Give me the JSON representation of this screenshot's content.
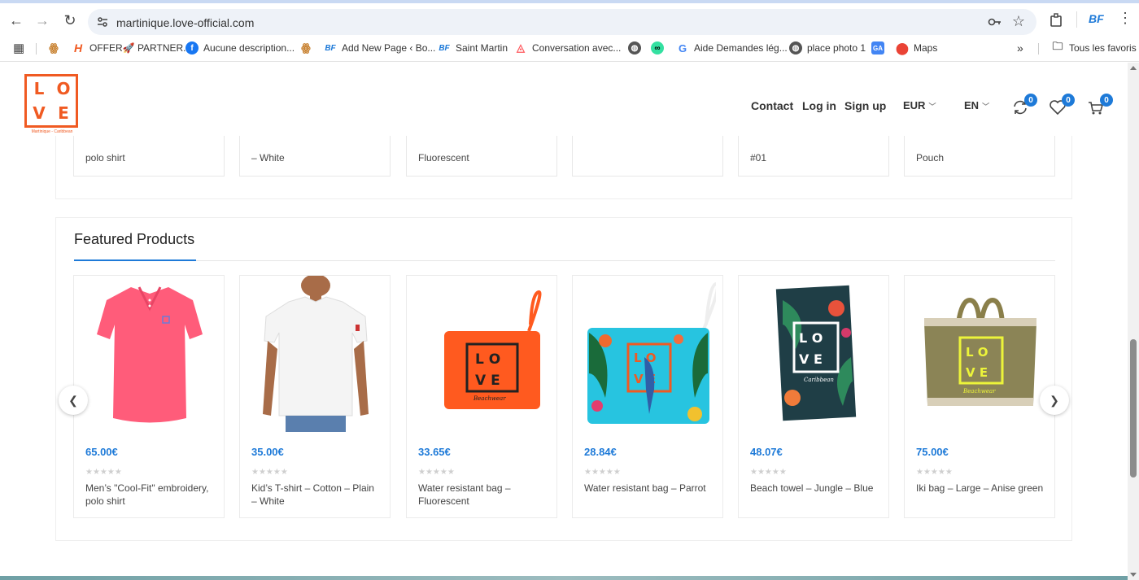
{
  "browser": {
    "url": "martinique.love-official.com",
    "bookmarks": [
      {
        "label": "",
        "icon": "squirrel-icon"
      },
      {
        "label": "OFFER🚀 PARTNER...",
        "icon": "h-logo-icon"
      },
      {
        "label": "Aucune description...",
        "icon": "facebook-icon"
      },
      {
        "label": "",
        "icon": "squirrel-icon"
      },
      {
        "label": "Add New Page ‹ Bo...",
        "icon": "bf-icon"
      },
      {
        "label": "Saint Martin",
        "icon": "bf-icon"
      },
      {
        "label": "Conversation avec...",
        "icon": "airbnb-icon"
      },
      {
        "label": "",
        "icon": "globe-icon"
      },
      {
        "label": "",
        "icon": "tripadvisor-icon"
      },
      {
        "label": "Aide Demandes lég...",
        "icon": "google-icon"
      },
      {
        "label": "place photo 1",
        "icon": "globe-icon"
      },
      {
        "label": "",
        "icon": "translate-icon"
      },
      {
        "label": "Maps",
        "icon": "maps-icon"
      }
    ],
    "bookmarks_overflow": "»",
    "all_bookmarks": "Tous les favoris"
  },
  "header": {
    "logo_letters": [
      "L",
      "O",
      "V",
      "E"
    ],
    "logo_sub": "Martinique - Caribbean",
    "nav": [
      "Contact",
      "Log in",
      "Sign up"
    ],
    "currency": "EUR",
    "language": "EN",
    "compare_count": "0",
    "wishlist_count": "0",
    "cart_count": "0"
  },
  "previous_row": [
    "polo shirt",
    "– White",
    "Fluorescent",
    "",
    "#01",
    "Pouch"
  ],
  "featured": {
    "title": "Featured Products",
    "products": [
      {
        "price": "65.00€",
        "name": "Men’s \"Cool-Fit\" embroidery, polo shirt",
        "image": "pink-polo-shirt"
      },
      {
        "price": "35.00€",
        "name": "Kid’s T-shirt – Cotton – Plain – White",
        "image": "white-tshirt"
      },
      {
        "price": "33.65€",
        "name": "Water resistant bag – Fluorescent",
        "image": "orange-pouch"
      },
      {
        "price": "28.84€",
        "name": "Water resistant bag – Parrot",
        "image": "parrot-pouch"
      },
      {
        "price": "48.07€",
        "name": "Beach towel – Jungle – Blue",
        "image": "jungle-towel"
      },
      {
        "price": "75.00€",
        "name": "Iki bag – Large – Anise green",
        "image": "jute-bag"
      }
    ],
    "stars": "★★★★★"
  },
  "colors": {
    "accent": "#1e7ad8",
    "brand": "#f05a22"
  }
}
